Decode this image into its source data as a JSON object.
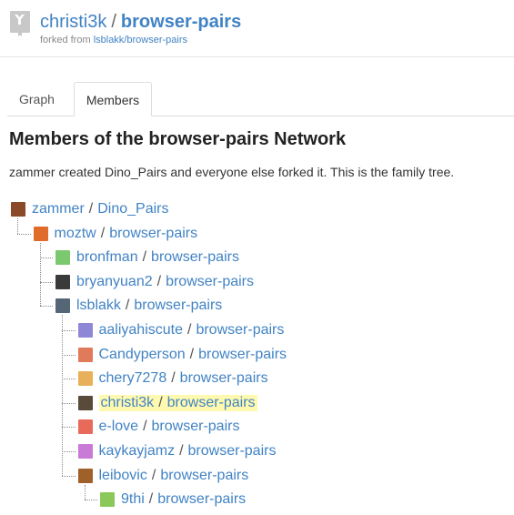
{
  "header": {
    "owner": "christi3k",
    "separator": "/",
    "repo": "browser-pairs",
    "forked_prefix": "forked from ",
    "forked_link": "lsblakk/browser-pairs",
    "repo_icon": "repo-fork-icon"
  },
  "tabs": [
    {
      "label": "Graph",
      "active": false
    },
    {
      "label": "Members",
      "active": true
    }
  ],
  "main": {
    "heading": "Members of the browser-pairs Network",
    "description": "zammer created Dino_Pairs and everyone else forked it. This is the family tree."
  },
  "colors": {
    "link": "#4183c4",
    "highlight": "#fff9b0"
  },
  "members": [
    {
      "user": "zammer",
      "repo": "Dino_Pairs",
      "avatar": "photo-avatar-icon",
      "avatar_color": "#8a4a2a"
    },
    {
      "user": "moztw",
      "repo": "browser-pairs",
      "avatar": "fox-avatar-icon",
      "avatar_color": "#e06b2a"
    },
    {
      "user": "bronfman",
      "repo": "browser-pairs",
      "avatar": "identicon-avatar-icon",
      "avatar_color": "#7bc96f"
    },
    {
      "user": "bryanyuan2",
      "repo": "browser-pairs",
      "avatar": "photo-avatar-icon",
      "avatar_color": "#3a3a3a"
    },
    {
      "user": "lsblakk",
      "repo": "browser-pairs",
      "avatar": "photo-avatar-icon",
      "avatar_color": "#556677"
    },
    {
      "user": "aaliyahiscute",
      "repo": "browser-pairs",
      "avatar": "identicon-avatar-icon",
      "avatar_color": "#8e87d6"
    },
    {
      "user": "Candyperson",
      "repo": "browser-pairs",
      "avatar": "identicon-avatar-icon",
      "avatar_color": "#e07a5a"
    },
    {
      "user": "chery7278",
      "repo": "browser-pairs",
      "avatar": "identicon-avatar-icon",
      "avatar_color": "#e8b05a"
    },
    {
      "user": "christi3k",
      "repo": "browser-pairs",
      "avatar": "photo-avatar-icon",
      "avatar_color": "#5a4a3a",
      "highlighted": true
    },
    {
      "user": "e-love",
      "repo": "browser-pairs",
      "avatar": "identicon-avatar-icon",
      "avatar_color": "#e86a5a"
    },
    {
      "user": "kaykayjamz",
      "repo": "browser-pairs",
      "avatar": "identicon-avatar-icon",
      "avatar_color": "#c87ad6"
    },
    {
      "user": "leibovic",
      "repo": "browser-pairs",
      "avatar": "photo-avatar-icon",
      "avatar_color": "#a0602a"
    },
    {
      "user": "9thi",
      "repo": "browser-pairs",
      "avatar": "identicon-avatar-icon",
      "avatar_color": "#8ac85a"
    }
  ]
}
